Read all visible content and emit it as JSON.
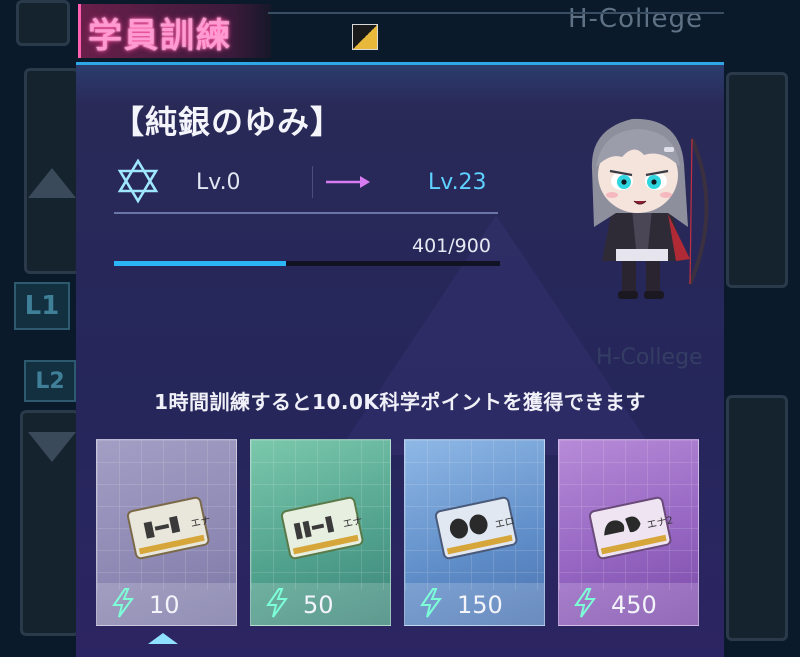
{
  "header": {
    "title": "学員訓練",
    "background_label": "H-College",
    "background_label_faded": "H-College",
    "side_buttons": [
      "L1",
      "L2"
    ]
  },
  "character": {
    "name": "【純銀のゆみ】",
    "level_from": "Lv.0",
    "level_to": "Lv.23",
    "exp_text": "401/900",
    "exp_fraction": 0.4456
  },
  "info": {
    "message": "1時間訓練すると10.0K科学ポイントを獲得できます"
  },
  "cards": [
    {
      "cost": "10",
      "ticket_label": "エナ"
    },
    {
      "cost": "50",
      "ticket_label": "エナ"
    },
    {
      "cost": "150",
      "ticket_label": "エロ"
    },
    {
      "cost": "450",
      "ticket_label": "エナ2"
    }
  ],
  "colors": {
    "accent": "#2bb7f5",
    "title_pink": "#ff9bd0",
    "level_target": "#5ed1ff",
    "panel_bg": "#2a2a58"
  },
  "icons": {
    "title_corner": "slash-icon",
    "level": "star-of-david-icon",
    "arrow": "arrow-right-icon",
    "energy": "lightning-bolt-icon",
    "selected": "triangle-up-icon"
  }
}
